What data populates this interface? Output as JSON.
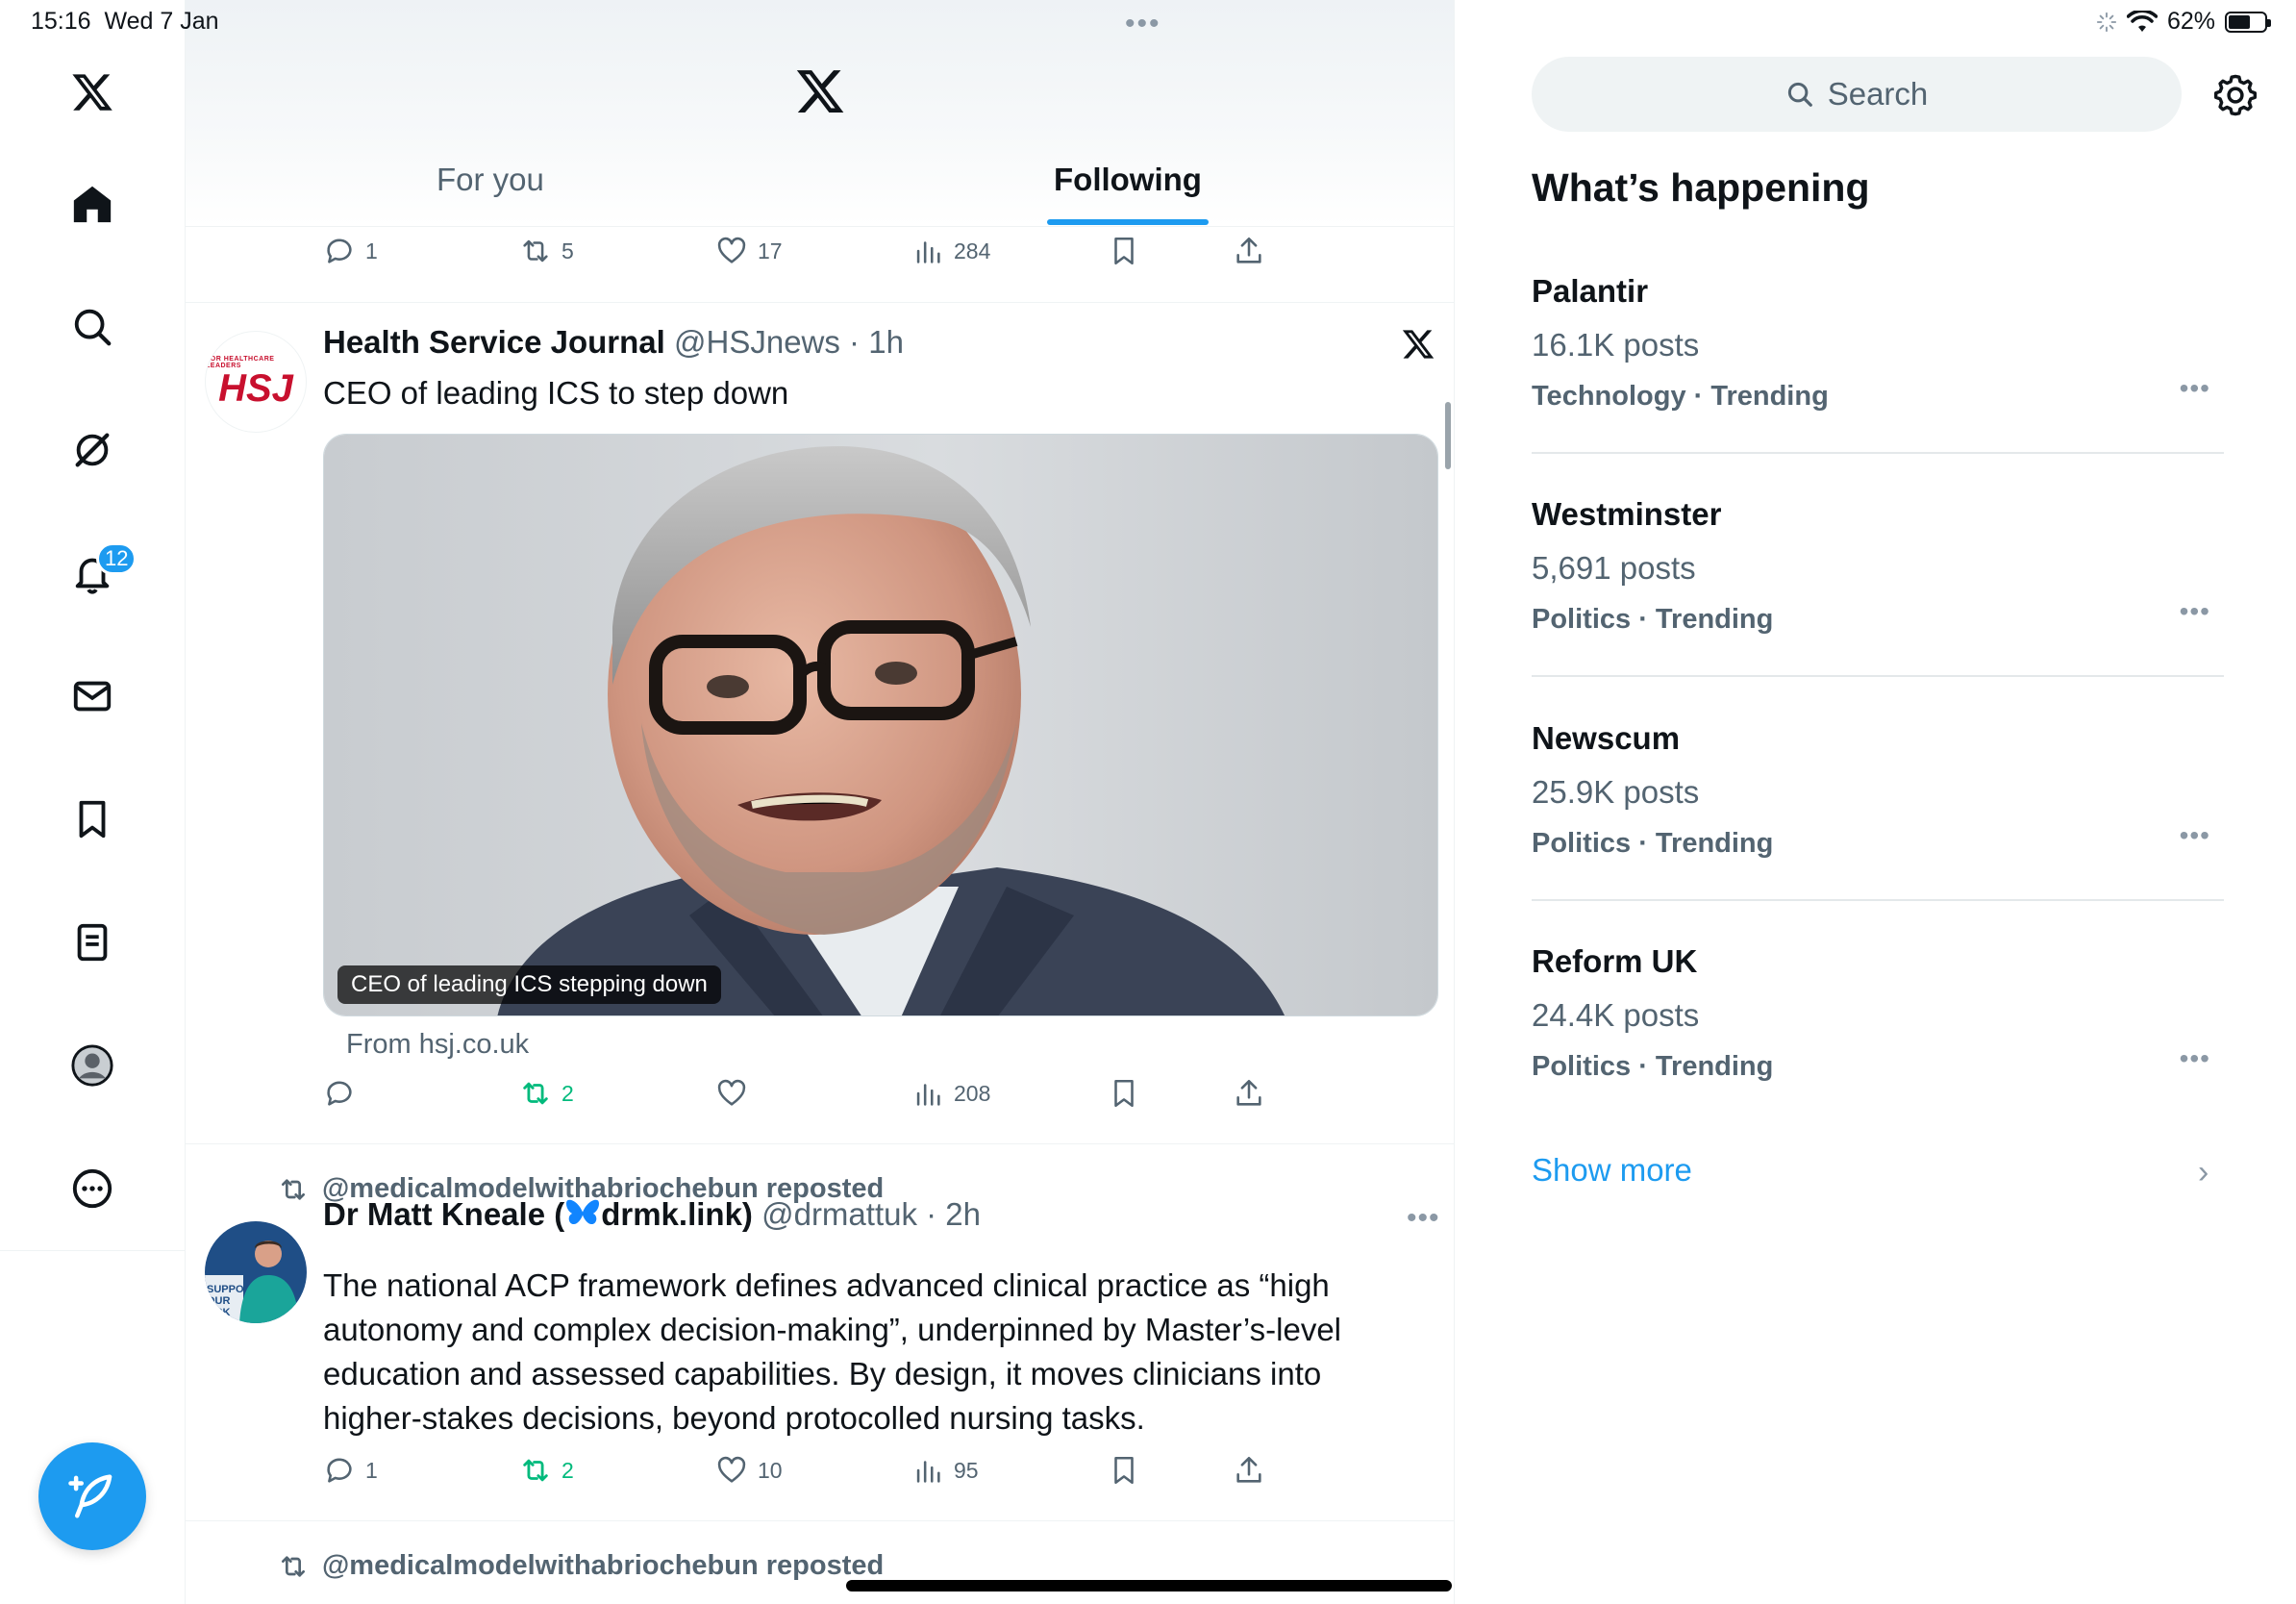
{
  "status_bar": {
    "time": "15:16",
    "date": "Wed 7 Jan",
    "battery": "62%",
    "battery_level": 0.62
  },
  "nav": {
    "icons": [
      "x-logo-icon",
      "home-icon",
      "search-icon",
      "grok-icon",
      "notifications-icon",
      "messages-icon",
      "bookmarks-icon",
      "lists-icon",
      "profile-icon",
      "more-icon"
    ],
    "notifications_count": "12"
  },
  "header": {
    "tabs": [
      {
        "label": "For you"
      },
      {
        "label": "Following"
      }
    ],
    "active_tab": "Following"
  },
  "prev_tweet": {
    "replies": "1",
    "reposts": "5",
    "likes": "17",
    "views": "284"
  },
  "tweet1": {
    "name": "Health Service Journal",
    "handle": "@HSJnews",
    "time": "1h",
    "avatar_text": "HSJ",
    "avatar_small": "FOR HEALTHCARE LEADERS",
    "text": "CEO of leading ICS to step down",
    "card_caption": "CEO of leading ICS stepping down",
    "card_source": "From hsj.co.uk",
    "reposts": "2",
    "views": "208"
  },
  "tweet2": {
    "reposted_by": "@medicalmodelwithabriochebun reposted",
    "name": "Dr Matt Kneale (",
    "name_suffix": "drmk.link)",
    "handle": "@drmattuk",
    "time": "2h",
    "text": "The national ACP framework defines advanced clinical practice as “high autonomy and complex decision-making”, underpinned by Master’s-level education and assessed capabilities. By design, it moves clinicians into higher-stakes decisions, beyond protocolled nursing tasks.",
    "replies": "1",
    "reposts": "2",
    "likes": "10",
    "views": "95"
  },
  "tweet3": {
    "reposted_by": "@medicalmodelwithabriochebun reposted"
  },
  "sidebar": {
    "search_placeholder": "Search",
    "title": "What’s happening",
    "trends": [
      {
        "name": "Palantir",
        "posts": "16.1K posts",
        "category": "Technology · Trending"
      },
      {
        "name": "Westminster",
        "posts": "5,691 posts",
        "category": "Politics · Trending"
      },
      {
        "name": "Newscum",
        "posts": "25.9K posts",
        "category": "Politics · Trending"
      },
      {
        "name": "Reform UK",
        "posts": "24.4K posts",
        "category": "Politics · Trending"
      }
    ],
    "show_more": "Show more"
  },
  "colors": {
    "accent": "#1d9bf0",
    "repost_green": "#00ba7c",
    "text_secondary": "#536471"
  }
}
